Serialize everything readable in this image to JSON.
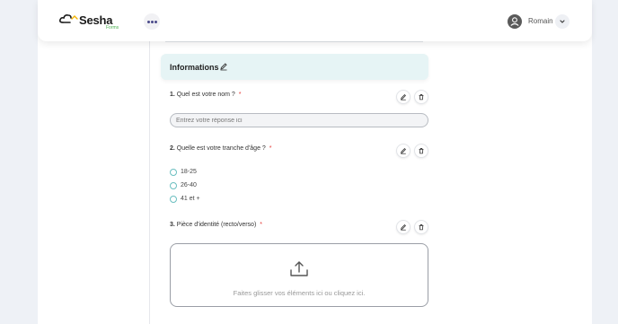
{
  "header": {
    "logo_text": "Sesha",
    "logo_sub": "Forms",
    "user_name": "Romain"
  },
  "section": {
    "title": "Informations"
  },
  "questions": [
    {
      "number": "1.",
      "label": "Quel est votre nom ?",
      "required": "*",
      "placeholder": "Entrez votre réponse ici"
    },
    {
      "number": "2.",
      "label": "Quelle est votre tranche d'âge ?",
      "required": "*",
      "options": [
        "18-25",
        "26-40",
        "41 et +"
      ]
    },
    {
      "number": "3.",
      "label": "Pièce d'identité (recto/verso)",
      "required": "*",
      "dropzone_text": "Faites glisser vos éléments ici ou cliquez ici."
    }
  ],
  "icons": {
    "edit": "pencil-icon",
    "delete": "trash-icon",
    "upload": "upload-icon",
    "user": "user-icon",
    "more": "more-dots-icon",
    "chevron": "chevron-down-icon"
  },
  "colors": {
    "accent": "#6bbfc0",
    "section_bg": "#e6f4f5",
    "required": "#e53935",
    "brand_green": "#4caf50"
  }
}
